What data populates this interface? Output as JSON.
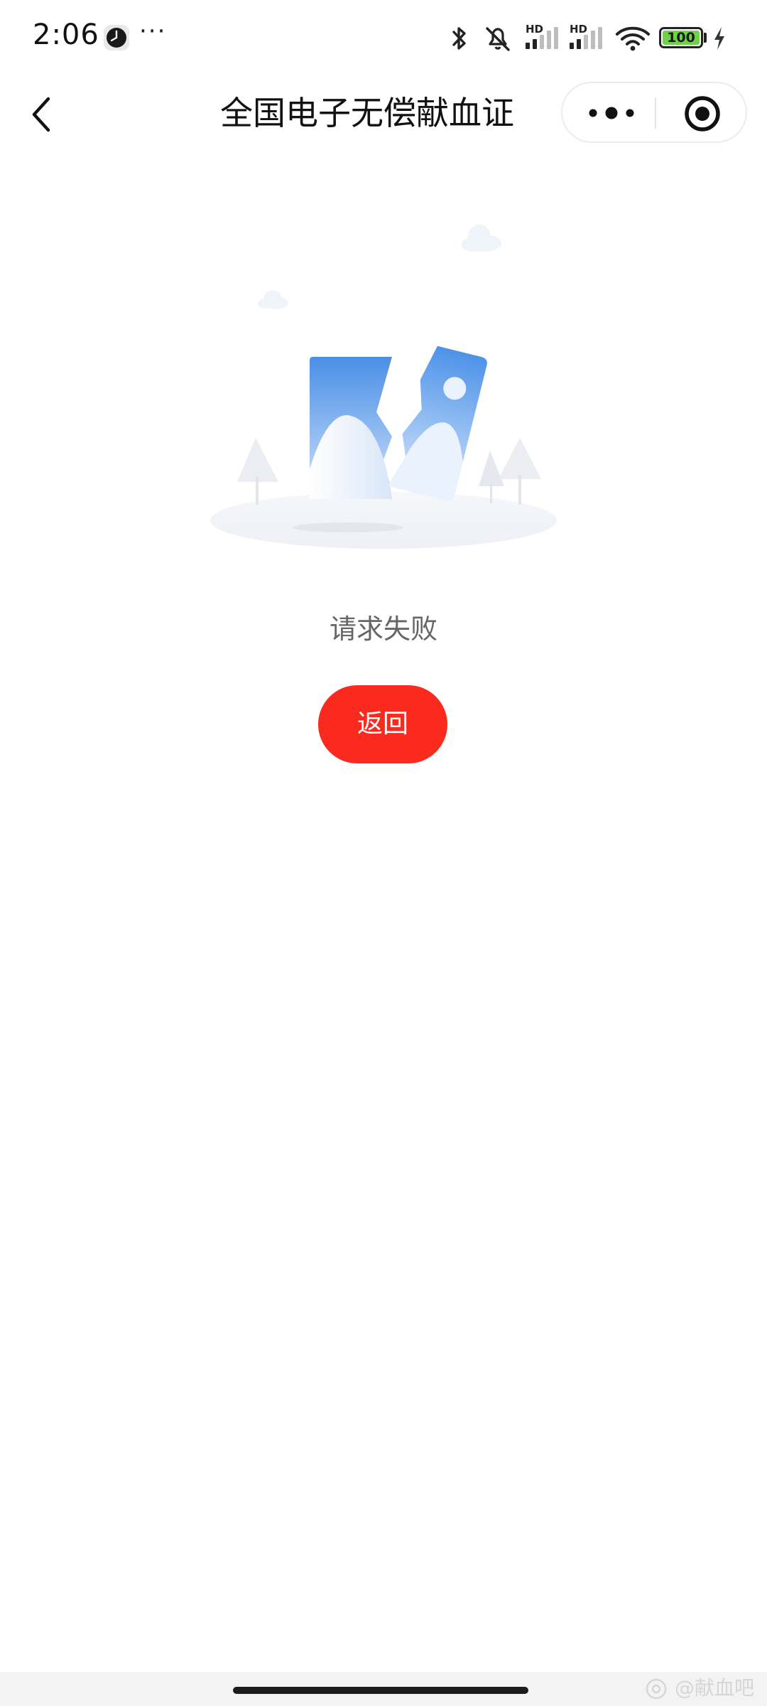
{
  "status_bar": {
    "time": "2:06",
    "more": "···",
    "signal_label_1": "HD",
    "signal_label_2": "HD",
    "battery_level": "100"
  },
  "nav_bar": {
    "title": "全国电子无偿献血证"
  },
  "main": {
    "error_message": "请求失败",
    "return_label": "返回"
  },
  "watermark": {
    "text": "@献血吧"
  },
  "colors": {
    "accent": "#fa2a1e",
    "battery": "#6fd14a",
    "illustration_blue": "#4a90e2"
  }
}
